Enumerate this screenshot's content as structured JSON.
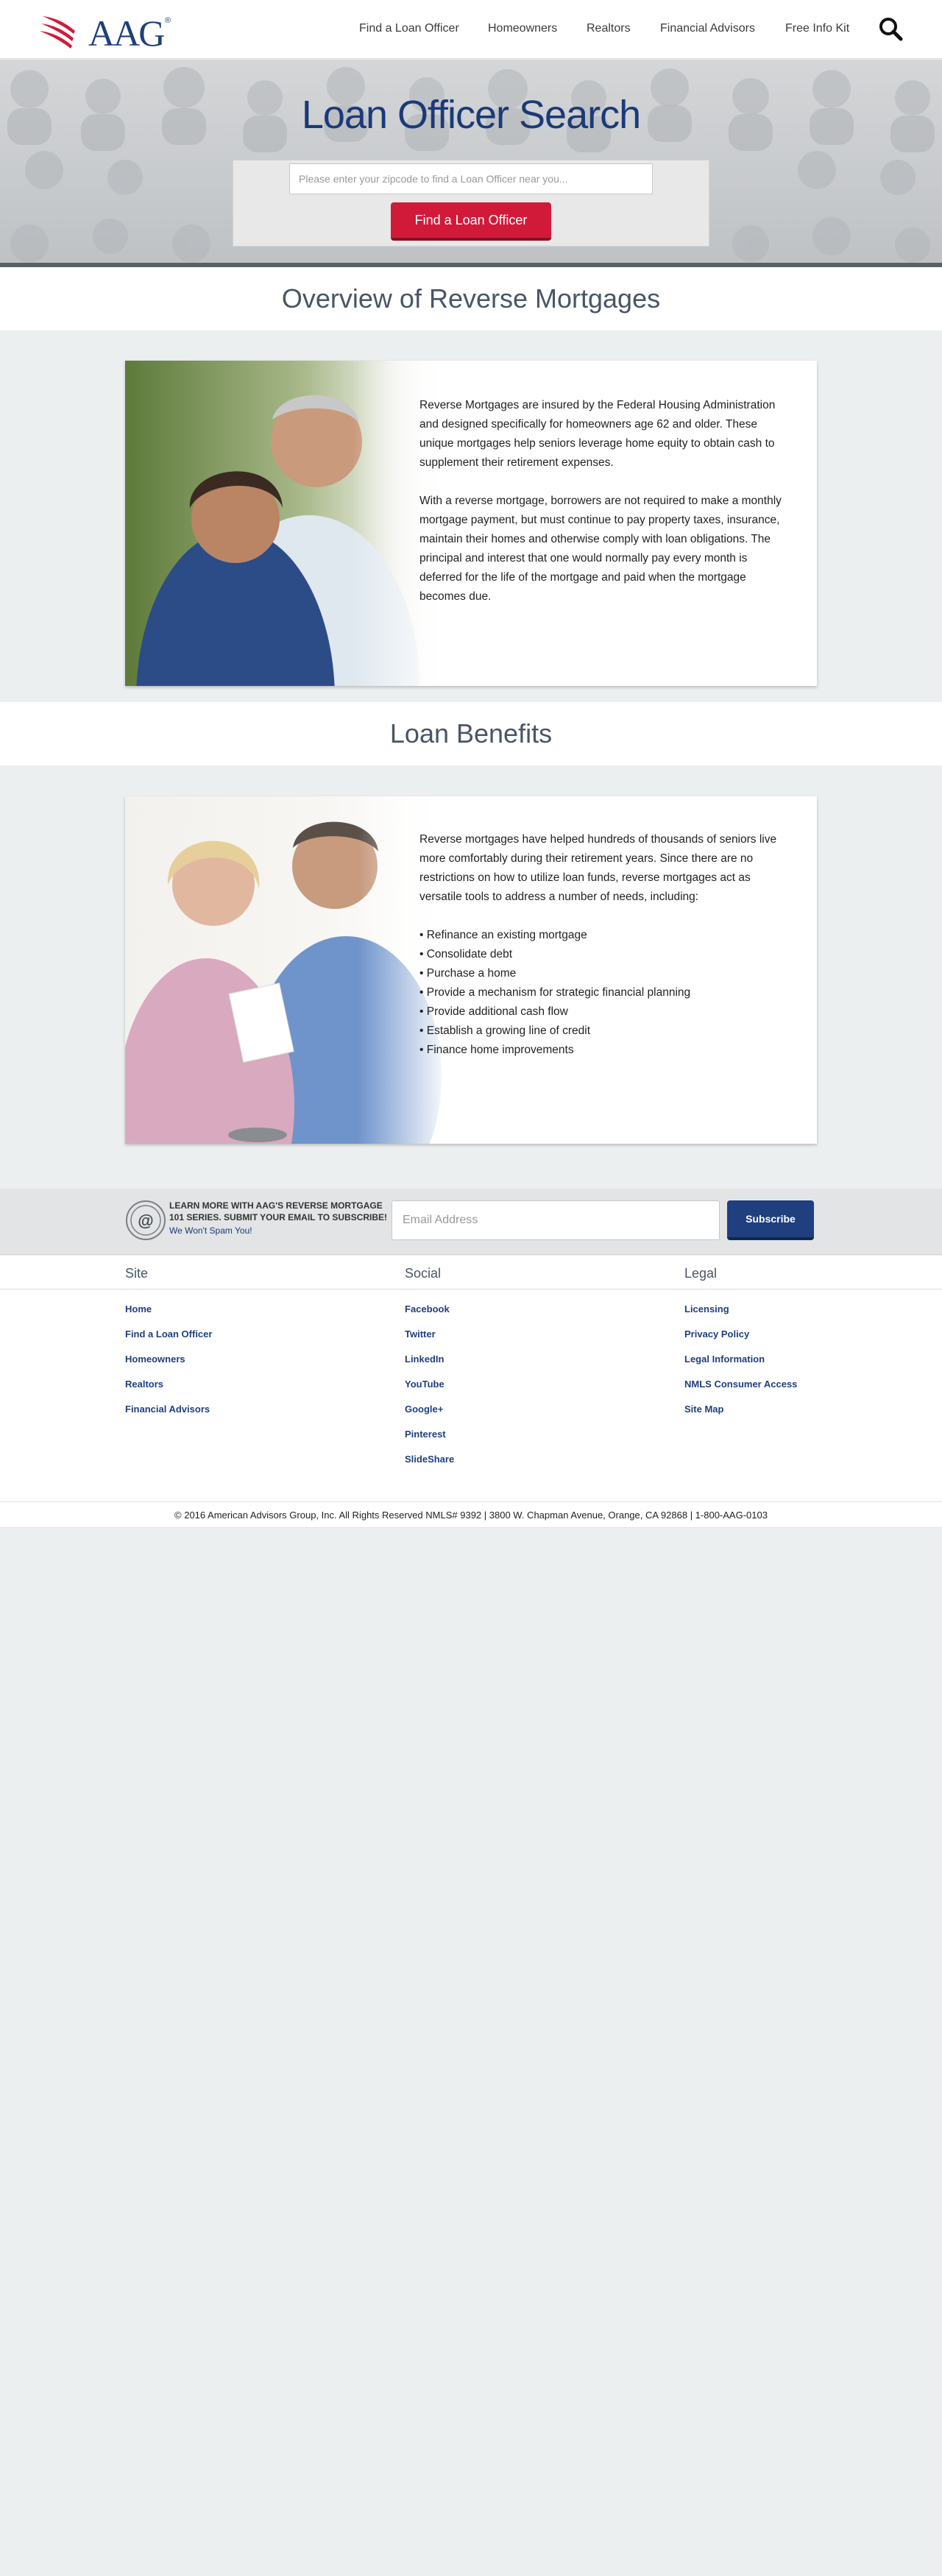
{
  "header": {
    "logo_text": "AAG",
    "logo_reg": "®",
    "nav": [
      {
        "label": "Find a Loan Officer"
      },
      {
        "label": "Homeowners"
      },
      {
        "label": "Realtors"
      },
      {
        "label": "Financial Advisors"
      },
      {
        "label": "Free Info Kit"
      }
    ],
    "search_icon": "search-icon"
  },
  "hero": {
    "title": "Loan Officer Search",
    "zip_placeholder": "Please enter your zipcode to find a Loan Officer near you...",
    "button_label": "Find a Loan Officer"
  },
  "overview": {
    "title": "Overview of Reverse Mortgages",
    "paragraph_1": "Reverse Mortgages are insured by the Federal Housing Administration and designed specifically for homeowners age 62 and older. These unique mortgages help seniors leverage home equity to obtain cash to supplement their retirement expenses.",
    "paragraph_2": "With a reverse mortgage, borrowers are not required to make a monthly mortgage payment, but must continue to pay property taxes, insurance, maintain their homes and otherwise comply with loan obligations. The principal and interest that one would normally pay every month is deferred for the life of the mortgage and paid when the mortgage becomes due."
  },
  "benefits": {
    "title": "Loan Benefits",
    "intro": "Reverse mortgages have helped hundreds of thousands of seniors live more comfortably during their retirement years. Since there are no restrictions on how to utilize loan funds, reverse mortgages act as versatile tools to address a number of needs, including:",
    "items": [
      "• Refinance an existing mortgage",
      "• Consolidate debt",
      "• Purchase a home",
      "• Provide a mechanism for strategic financial planning",
      "• Provide additional cash flow",
      "• Establish a growing line of credit",
      "• Finance home improvements"
    ]
  },
  "subscribe": {
    "text": "LEARN MORE WITH AAG'S REVERSE MORTGAGE 101 SERIES. SUBMIT YOUR EMAIL TO SUBSCRIBE!",
    "spam_note": "We Won't Spam You!",
    "email_placeholder": "Email Address",
    "button_label": "Subscribe"
  },
  "footer": {
    "columns": [
      {
        "heading": "Site",
        "links": [
          "Home",
          "Find a Loan Officer",
          "Homeowners",
          "Realtors",
          "Financial Advisors"
        ]
      },
      {
        "heading": "Social",
        "links": [
          "Facebook",
          "Twitter",
          "LinkedIn",
          "YouTube",
          "Google+",
          "Pinterest",
          "SlideShare"
        ]
      },
      {
        "heading": "Legal",
        "links": [
          "Licensing",
          "Privacy Policy",
          "Legal Information",
          "NMLS Consumer Access",
          "Site Map"
        ]
      }
    ],
    "copyright": "© 2016 American Advisors Group, Inc. All Rights Reserved NMLS# 9392 | 3800 W. Chapman Avenue, Orange, CA 92868 | 1-800-AAG-0103"
  },
  "colors": {
    "brand_navy": "#1f3f7f",
    "brand_red": "#d11a3a",
    "page_bg": "#eceff0"
  }
}
